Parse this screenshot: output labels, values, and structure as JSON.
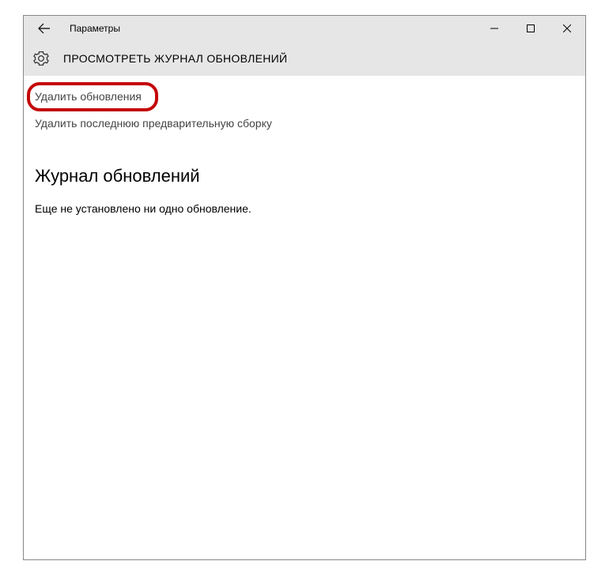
{
  "titlebar": {
    "title": "Параметры"
  },
  "header": {
    "page_title": "ПРОСМОТРЕТЬ ЖУРНАЛ ОБНОВЛЕНИЙ"
  },
  "content": {
    "link_remove_updates": "Удалить обновления",
    "link_remove_preview": "Удалить последнюю предварительную сборку",
    "section_heading": "Журнал обновлений",
    "empty_text": "Еще не установлено ни одно обновление."
  }
}
